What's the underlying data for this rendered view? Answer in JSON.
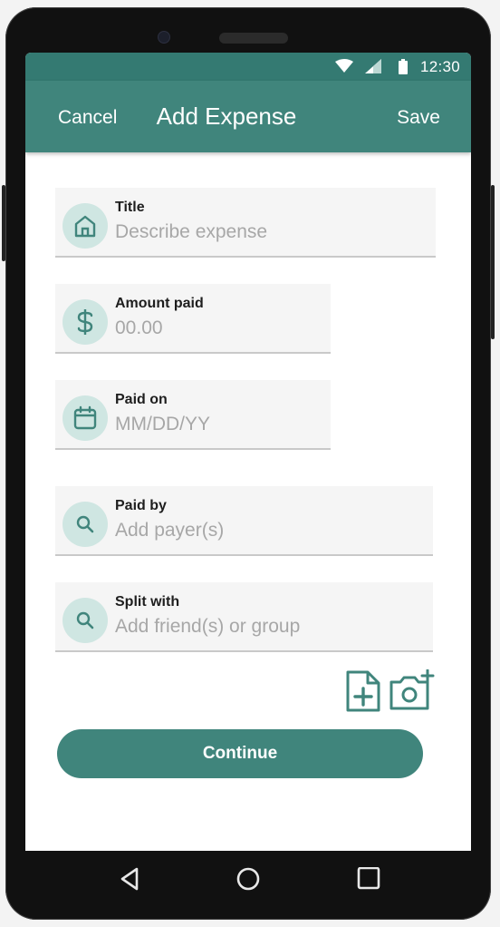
{
  "status_bar": {
    "time": "12:30",
    "icons": [
      "wifi-icon",
      "cell-signal-icon",
      "battery-icon"
    ]
  },
  "app_bar": {
    "cancel_label": "Cancel",
    "title": "Add Expense",
    "save_label": "Save"
  },
  "form": {
    "title": {
      "label": "Title",
      "placeholder": "Describe expense",
      "value": "",
      "icon": "home-icon"
    },
    "amount": {
      "label": "Amount paid",
      "placeholder": "00.00",
      "value": "",
      "icon": "dollar-icon"
    },
    "paid_on": {
      "label": "Paid on",
      "placeholder": "MM/DD/YY",
      "value": "",
      "icon": "calendar-icon"
    },
    "paid_by": {
      "label": "Paid by",
      "placeholder": "Add payer(s)",
      "value": "",
      "icon": "search-icon"
    },
    "split_with": {
      "label": "Split with",
      "placeholder": "Add friend(s) or group",
      "value": "",
      "icon": "search-icon"
    }
  },
  "attachments": {
    "icons": [
      "add-document-icon",
      "add-photo-icon"
    ]
  },
  "continue_label": "Continue",
  "nav_bar": {
    "icons": [
      "back-triangle-icon",
      "home-circle-icon",
      "recents-square-icon"
    ]
  },
  "colors": {
    "primary": "#40857c",
    "status_bar": "#347a72",
    "icon_bg": "#cfe6e2",
    "field_bg": "#f5f5f5"
  }
}
